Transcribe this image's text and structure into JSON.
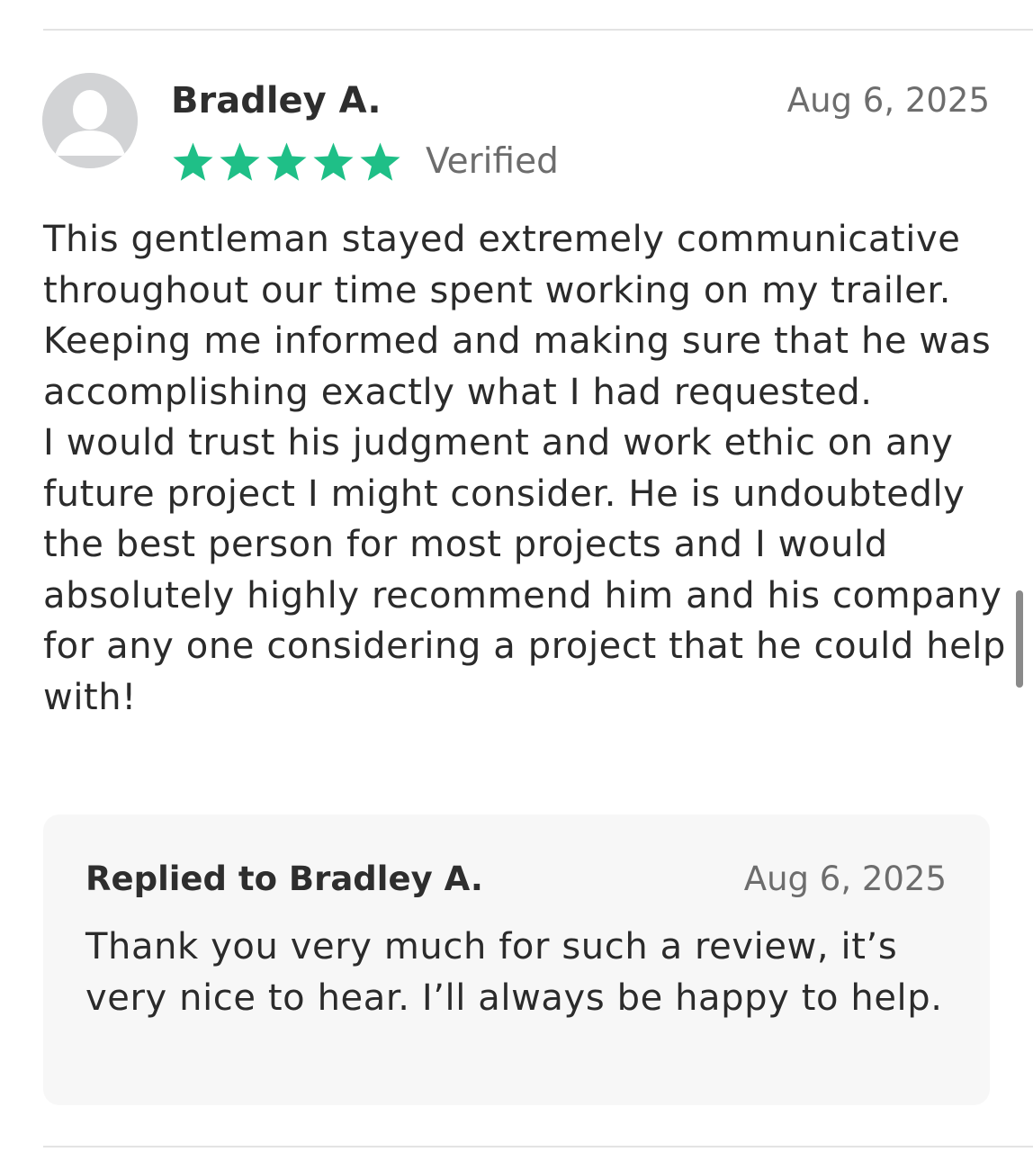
{
  "review": {
    "reviewer_name": "Bradley A.",
    "date": "Aug 6, 2025",
    "rating": 5,
    "verified_label": "Verified",
    "star_color": "#1fbf87",
    "body_paragraph_1": "This gentleman stayed extremely communicative throughout our time spent working on my trailer. Keeping me informed and making sure that he was accomplishing exactly what I had requested.",
    "body_paragraph_2": "I would trust his judgment and work ethic on any future project I might consider. He is undoubtedly the best person for most projects and I would absolutely highly recommend him and his company for any one considering a project that he could help with!"
  },
  "reply": {
    "title": "Replied to Bradley A.",
    "date": "Aug 6, 2025",
    "body": "Thank you very much for such a review, it’s very nice to hear. I’ll always be happy to help."
  },
  "icons": {
    "avatar": "user-placeholder-icon",
    "star": "star-icon"
  }
}
